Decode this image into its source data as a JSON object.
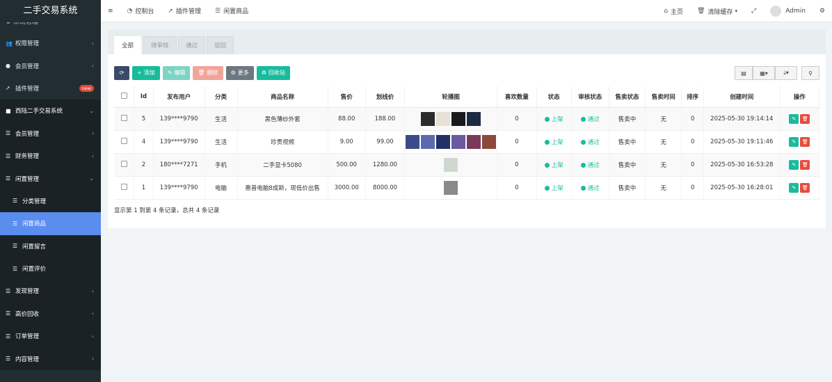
{
  "app": {
    "title": "二手交易系统"
  },
  "sidebar": {
    "cut_item": "系统管理",
    "items": [
      {
        "label": "权限管理",
        "icon": "users-icon"
      },
      {
        "label": "会员管理",
        "icon": "user-circle-icon"
      },
      {
        "label": "插件管理",
        "icon": "rocket-icon",
        "badge": "new"
      },
      {
        "label": "西陆二手交易系统",
        "icon": "folder-icon"
      },
      {
        "label": "会员管理",
        "icon": "list-icon"
      },
      {
        "label": "财务管理",
        "icon": "list-icon"
      },
      {
        "label": "闲置管理",
        "icon": "list-icon"
      },
      {
        "label": "分类管理",
        "icon": "list-icon"
      },
      {
        "label": "闲置商品",
        "icon": "list-icon"
      },
      {
        "label": "闲置留言",
        "icon": "list-icon"
      },
      {
        "label": "闲置评价",
        "icon": "list-icon"
      },
      {
        "label": "发现管理",
        "icon": "list-icon"
      },
      {
        "label": "高价回收",
        "icon": "list-icon"
      },
      {
        "label": "订单管理",
        "icon": "list-icon"
      },
      {
        "label": "内容管理",
        "icon": "list-icon"
      }
    ]
  },
  "topbar": {
    "menu_icon": "≡",
    "nav": [
      {
        "label": "控制台",
        "icon": "dashboard-icon"
      },
      {
        "label": "插件管理",
        "icon": "rocket-icon"
      },
      {
        "label": "闲置商品",
        "icon": "list-icon"
      }
    ],
    "home": "主页",
    "clear_cache": "清除缓存",
    "user": "Admin"
  },
  "tabs": [
    "全部",
    "待审核",
    "通过",
    "驳回"
  ],
  "toolbar": {
    "add": "添加",
    "edit": "编辑",
    "delete": "删除",
    "more": "更多",
    "recycle": "回收站"
  },
  "table": {
    "headers": [
      "Id",
      "发布用户",
      "分类",
      "商品名称",
      "售价",
      "划线价",
      "轮播图",
      "喜欢数量",
      "状态",
      "审核状态",
      "售卖状态",
      "售卖时间",
      "排序",
      "创建时间",
      "操作"
    ],
    "rows": [
      {
        "id": "5",
        "user": "139****9790",
        "cat": "生活",
        "name": "黑色薄纱外套",
        "price": "88.00",
        "orig": "188.00",
        "thumbs": [
          "#2b2b2b",
          "#e6e0d6",
          "#1a1a1a",
          "#1c2a44"
        ],
        "likes": "0",
        "status": "上架",
        "audit": "通过",
        "sale": "售卖中",
        "sale_time": "无",
        "sort": "0",
        "created": "2025-05-30 19:14:14"
      },
      {
        "id": "4",
        "user": "139****9790",
        "cat": "生活",
        "name": "珍贵视频",
        "price": "9.00",
        "orig": "99.00",
        "thumbs": [
          "#3a4a8a",
          "#5a6ab0",
          "#223066",
          "#6a5aa0",
          "#7a3a5a",
          "#8a4a3a"
        ],
        "likes": "0",
        "status": "上架",
        "audit": "通过",
        "sale": "售卖中",
        "sale_time": "无",
        "sort": "0",
        "created": "2025-05-30 19:11:46"
      },
      {
        "id": "2",
        "user": "180****7271",
        "cat": "手机",
        "name": "二手显卡5080",
        "price": "500.00",
        "orig": "1280.00",
        "thumbs": [
          "#cfd8cf"
        ],
        "likes": "0",
        "status": "上架",
        "audit": "通过",
        "sale": "售卖中",
        "sale_time": "无",
        "sort": "0",
        "created": "2025-05-30 16:53:28"
      },
      {
        "id": "1",
        "user": "139****9790",
        "cat": "电脑",
        "name": "惠普电脑8成新，现低价出售",
        "price": "3000.00",
        "orig": "8000.00",
        "thumbs": [
          "#8a8a8a"
        ],
        "likes": "0",
        "status": "上架",
        "audit": "通过",
        "sale": "售卖中",
        "sale_time": "无",
        "sort": "0",
        "created": "2025-05-30 16:28:01"
      }
    ]
  },
  "summary": "显示第 1 到第 4 条记录，总共 4 条记录"
}
